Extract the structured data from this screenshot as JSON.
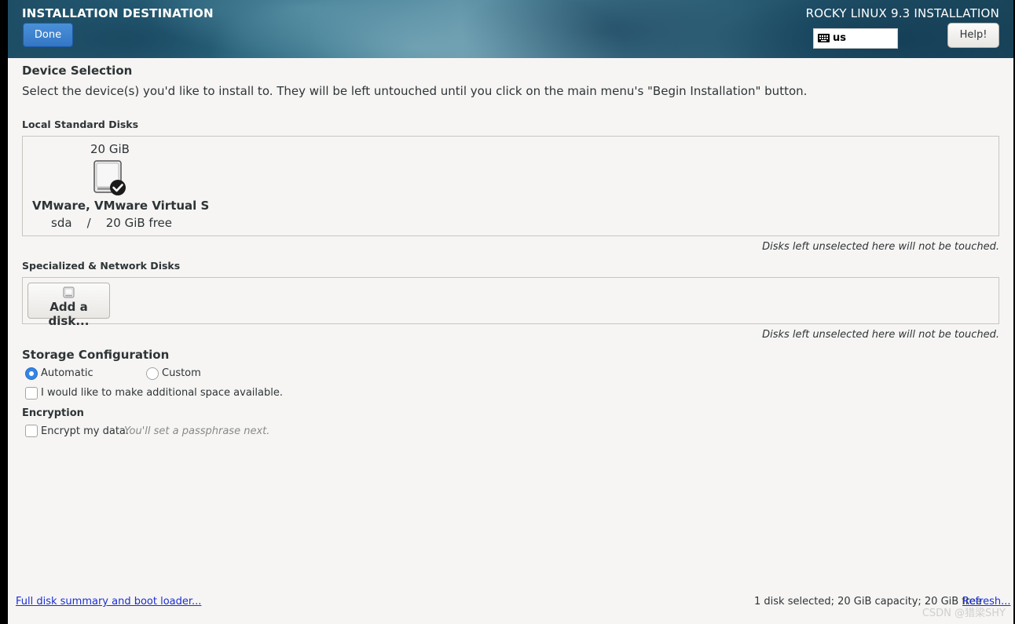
{
  "header": {
    "title": "INSTALLATION DESTINATION",
    "done_label": "Done",
    "product": "ROCKY LINUX 9.3 INSTALLATION",
    "keyboard_layout": "us",
    "help_label": "Help!"
  },
  "device_selection": {
    "heading": "Device Selection",
    "description": "Select the device(s) you'd like to install to.  They will be left untouched until you click on the main menu's \"Begin Installation\" button."
  },
  "local_disks": {
    "label": "Local Standard Disks",
    "disks": [
      {
        "size": "20 GiB",
        "name": "VMware, VMware Virtual S",
        "info": "sda    /    20 GiB free",
        "selected": true
      }
    ],
    "note": "Disks left unselected here will not be touched."
  },
  "special_disks": {
    "label": "Specialized & Network Disks",
    "add_label": "Add a disk...",
    "note": "Disks left unselected here will not be touched."
  },
  "storage": {
    "heading": "Storage Configuration",
    "automatic_label": "Automatic",
    "custom_label": "Custom",
    "selected": "Automatic",
    "space_label": "I would like to make additional space available."
  },
  "encryption": {
    "heading": "Encryption",
    "encrypt_label": "Encrypt my data.",
    "hint": "You'll set a passphrase next."
  },
  "footer": {
    "summary_link": "Full disk summary and boot loader...",
    "status": "1 disk selected; 20 GiB capacity; 20 GiB free",
    "refresh_link": "Refresh...",
    "watermark": "CSDN @猎梁SHY"
  },
  "colors": {
    "accent": "#3584e4",
    "link": "#1a2fd6",
    "background": "#f6f5f4"
  }
}
